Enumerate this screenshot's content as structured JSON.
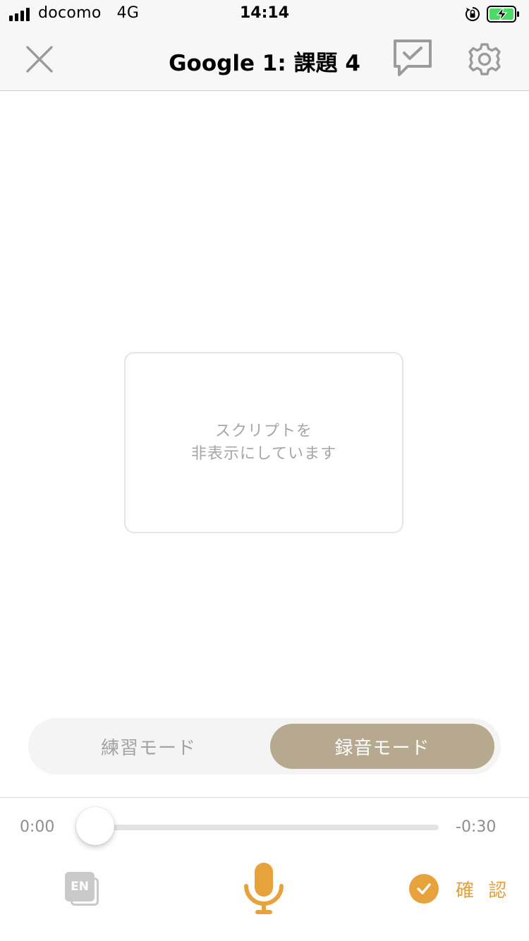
{
  "status_bar": {
    "carrier": "docomo",
    "network": "4G",
    "time": "14:14",
    "icons": [
      "signal-icon",
      "orientation-lock-icon",
      "battery-charging-icon"
    ]
  },
  "nav": {
    "title": "Google 1: 課題 4",
    "icons": [
      "close-icon",
      "feedback-check-icon",
      "gear-icon"
    ]
  },
  "script_card": {
    "line1": "スクリプトを",
    "line2": "非表示にしています"
  },
  "mode_switch": {
    "practice_label": "練習モード",
    "record_label": "録音モード",
    "selected": "録音モード"
  },
  "player": {
    "elapsed": "0:00",
    "remaining": "-0:30",
    "progress": 0
  },
  "toolbar": {
    "lang_label": "EN",
    "confirm_label": "確 認",
    "icons": [
      "language-toggle-icon",
      "microphone-icon",
      "check-circle-icon"
    ]
  },
  "colors": {
    "accent": "#e8a23c",
    "mode_selected": "#b7a98f",
    "battery": "#4cd964"
  }
}
